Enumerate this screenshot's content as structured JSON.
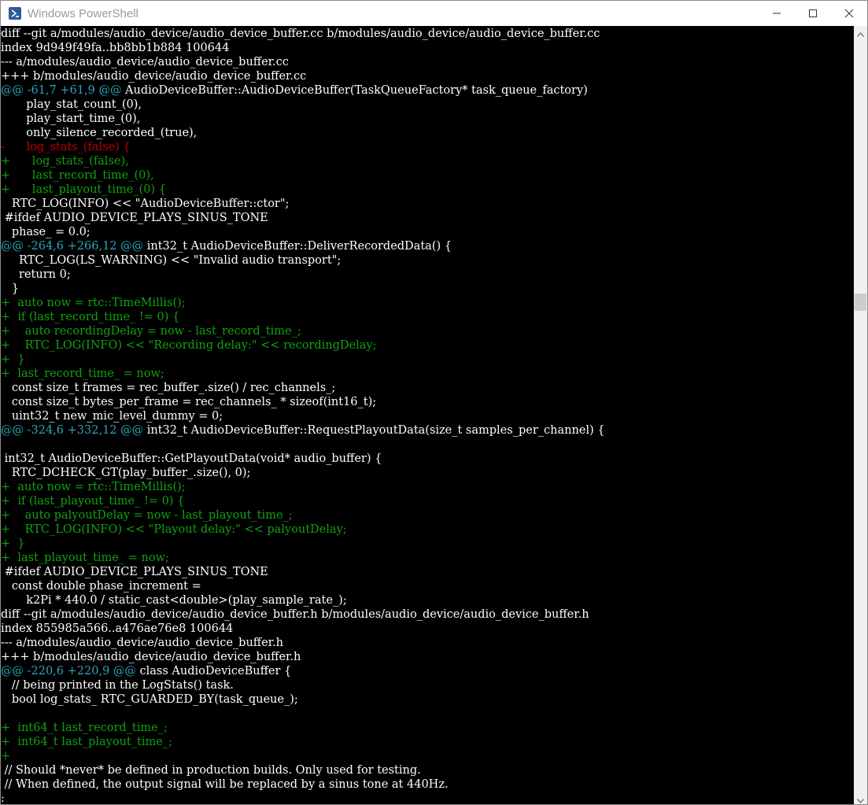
{
  "window": {
    "title": "Windows PowerShell",
    "icon": "powershell-icon",
    "controls": [
      "minimize-icon",
      "maximize-icon",
      "close-icon"
    ]
  },
  "console": {
    "lines": [
      {
        "type": "plain",
        "text": "diff --git a/modules/audio_device/audio_device_buffer.cc b/modules/audio_device/audio_device_buffer.cc"
      },
      {
        "type": "plain",
        "text": "index 9d949f49fa..bb8bb1b884 100644"
      },
      {
        "type": "plain",
        "text": "--- a/modules/audio_device/audio_device_buffer.cc"
      },
      {
        "type": "plain",
        "text": "+++ b/modules/audio_device/audio_device_buffer.cc"
      },
      {
        "type": "hunk",
        "head": "@@ -61,7 +61,9 @@",
        "text": " AudioDeviceBuffer::AudioDeviceBuffer(TaskQueueFactory* task_queue_factory)"
      },
      {
        "type": "plain",
        "text": "       play_stat_count_(0),"
      },
      {
        "type": "plain",
        "text": "       play_start_time_(0),"
      },
      {
        "type": "plain",
        "text": "       only_silence_recorded_(true),"
      },
      {
        "type": "removed",
        "text": "-      log_stats_(false) {"
      },
      {
        "type": "added",
        "text": "+      log_stats_(false),"
      },
      {
        "type": "added",
        "text": "+      last_record_time_(0),"
      },
      {
        "type": "added",
        "text": "+      last_playout_time_(0) {"
      },
      {
        "type": "plain",
        "text": "   RTC_LOG(INFO) << \"AudioDeviceBuffer::ctor\";"
      },
      {
        "type": "plain",
        "text": " #ifdef AUDIO_DEVICE_PLAYS_SINUS_TONE"
      },
      {
        "type": "plain",
        "text": "   phase_ = 0.0;"
      },
      {
        "type": "hunk",
        "head": "@@ -264,6 +266,12 @@",
        "text": " int32_t AudioDeviceBuffer::DeliverRecordedData() {"
      },
      {
        "type": "plain",
        "text": "     RTC_LOG(LS_WARNING) << \"Invalid audio transport\";"
      },
      {
        "type": "plain",
        "text": "     return 0;"
      },
      {
        "type": "plain",
        "text": "   }"
      },
      {
        "type": "added",
        "text": "+  auto now = rtc::TimeMillis();"
      },
      {
        "type": "added",
        "text": "+  if (last_record_time_ != 0) {"
      },
      {
        "type": "added",
        "text": "+    auto recordingDelay = now - last_record_time_;"
      },
      {
        "type": "added",
        "text": "+    RTC_LOG(INFO) << \"Recording delay:\" << recordingDelay;"
      },
      {
        "type": "added",
        "text": "+  }"
      },
      {
        "type": "added",
        "text": "+  last_record_time_ = now;"
      },
      {
        "type": "plain",
        "text": "   const size_t frames = rec_buffer_.size() / rec_channels_;"
      },
      {
        "type": "plain",
        "text": "   const size_t bytes_per_frame = rec_channels_ * sizeof(int16_t);"
      },
      {
        "type": "plain",
        "text": "   uint32_t new_mic_level_dummy = 0;"
      },
      {
        "type": "hunk",
        "head": "@@ -324,6 +332,12 @@",
        "text": " int32_t AudioDeviceBuffer::RequestPlayoutData(size_t samples_per_channel) {"
      },
      {
        "type": "plain",
        "text": ""
      },
      {
        "type": "plain",
        "text": " int32_t AudioDeviceBuffer::GetPlayoutData(void* audio_buffer) {"
      },
      {
        "type": "plain",
        "text": "   RTC_DCHECK_GT(play_buffer_.size(), 0);"
      },
      {
        "type": "added",
        "text": "+  auto now = rtc::TimeMillis();"
      },
      {
        "type": "added",
        "text": "+  if (last_playout_time_ != 0) {"
      },
      {
        "type": "added",
        "text": "+    auto palyoutDelay = now - last_playout_time_;"
      },
      {
        "type": "added",
        "text": "+    RTC_LOG(INFO) << \"Playout delay:\" << palyoutDelay;"
      },
      {
        "type": "added",
        "text": "+  }"
      },
      {
        "type": "added",
        "text": "+  last_playout_time_ = now;"
      },
      {
        "type": "plain",
        "text": " #ifdef AUDIO_DEVICE_PLAYS_SINUS_TONE"
      },
      {
        "type": "plain",
        "text": "   const double phase_increment ="
      },
      {
        "type": "plain",
        "text": "       k2Pi * 440.0 / static_cast<double>(play_sample_rate_);"
      },
      {
        "type": "plain",
        "text": "diff --git a/modules/audio_device/audio_device_buffer.h b/modules/audio_device/audio_device_buffer.h"
      },
      {
        "type": "plain",
        "text": "index 855985a566..a476ae76e8 100644"
      },
      {
        "type": "plain",
        "text": "--- a/modules/audio_device/audio_device_buffer.h"
      },
      {
        "type": "plain",
        "text": "+++ b/modules/audio_device/audio_device_buffer.h"
      },
      {
        "type": "hunk",
        "head": "@@ -220,6 +220,9 @@",
        "text": " class AudioDeviceBuffer {"
      },
      {
        "type": "plain",
        "text": "   // being printed in the LogStats() task."
      },
      {
        "type": "plain",
        "text": "   bool log_stats_ RTC_GUARDED_BY(task_queue_);"
      },
      {
        "type": "plain",
        "text": ""
      },
      {
        "type": "added",
        "text": "+  int64_t last_record_time_;"
      },
      {
        "type": "added",
        "text": "+  int64_t last_playout_time_;"
      },
      {
        "type": "added",
        "text": "+"
      },
      {
        "type": "plain",
        "text": " // Should *never* be defined in production builds. Only used for testing."
      },
      {
        "type": "plain",
        "text": " // When defined, the output signal will be replaced by a sinus tone at 440Hz."
      },
      {
        "type": "plain",
        "text": ":"
      }
    ]
  },
  "colors": {
    "background": "#000000",
    "text": "#ffffff",
    "added": "#12a112",
    "removed": "#b80000",
    "hunk": "#2ca7b6"
  }
}
